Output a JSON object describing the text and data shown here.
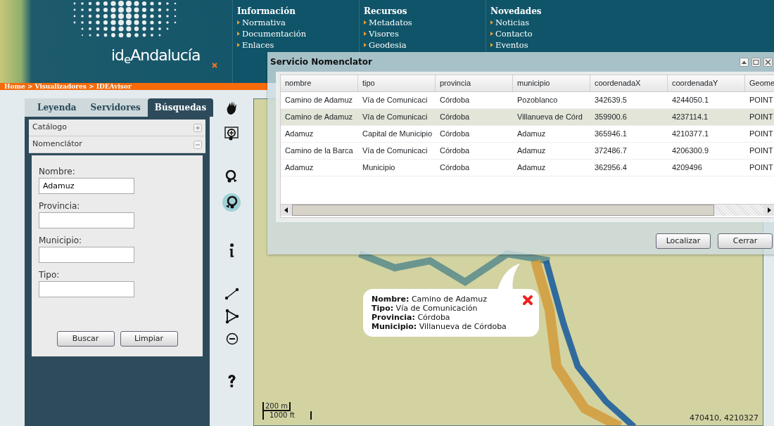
{
  "header": {
    "logo": "id$_{e}$Andalucía",
    "menus": [
      {
        "title": "Información",
        "links": [
          "Normativa",
          "Documentación",
          "Enlaces"
        ]
      },
      {
        "title": "Recursos",
        "links": [
          "Metadatos",
          "Visores",
          "Geodesia"
        ]
      },
      {
        "title": "Novedades",
        "links": [
          "Noticias",
          "Contacto",
          "Eventos"
        ]
      }
    ]
  },
  "breadcrumb": "Home > Visualizadores > IDEAvisor",
  "sidebar": {
    "tabs": [
      {
        "label": "Leyenda",
        "selected": false
      },
      {
        "label": "Servidores",
        "selected": false
      },
      {
        "label": "Búsquedas",
        "selected": true
      }
    ],
    "sections": [
      {
        "title": "Catálogo",
        "expanded": false
      },
      {
        "title": "Nomenclátor",
        "expanded": true
      }
    ],
    "form": {
      "fields": [
        {
          "label": "Nombre:",
          "value": "Adamuz"
        },
        {
          "label": "Provincia:"
        },
        {
          "label": "Municipio:"
        },
        {
          "label": "Tipo:"
        }
      ],
      "buttons": [
        "Buscar",
        "Limpiar"
      ]
    }
  },
  "toolbar": [
    {
      "kind": "pan",
      "selected": false
    },
    {
      "kind": "zoom-box",
      "selected": false
    },
    {
      "kind": "zoom-in",
      "selected": false
    },
    {
      "kind": "zoom-out",
      "selected": true
    },
    {
      "kind": "info",
      "selected": false
    },
    {
      "kind": "line",
      "selected": false
    },
    {
      "kind": "area",
      "selected": false
    },
    {
      "kind": "clear",
      "selected": false
    },
    {
      "kind": "help",
      "selected": false
    }
  ],
  "map": {
    "popup": {
      "lines": [
        "**Nombre:** Camino de Adamuz",
        "**Tipo:** Vía de Comunicación",
        "**Provincia:** Córdoba",
        "**Municipio:** Villanueva de Córdoba"
      ]
    },
    "scale": [
      "200 m",
      "1000 ft"
    ],
    "coordinates": "470410, 4210327"
  },
  "dialog": {
    "title": "Servicio Nomenclator",
    "table": {
      "columns": [
        "nombre",
        "tipo",
        "provincia",
        "municipio",
        "coordenadaX",
        "coordenadaY",
        "Geome"
      ],
      "rows": [
        {
          "selected": false,
          "cells": [
            "Camino de Adamuz",
            "Vía de Comunicaci",
            "Córdoba",
            "Pozoblanco",
            "342639.5",
            "4244050.1",
            "POINT"
          ]
        },
        {
          "selected": true,
          "cells": [
            "Camino de Adamuz",
            "Vía de Comunicaci",
            "Córdoba",
            "Villanueva de Córd",
            "359900.6",
            "4237114.1",
            "POINT"
          ]
        },
        {
          "selected": false,
          "cells": [
            "Adamuz",
            "Capital de Municipio",
            "Córdoba",
            "Adamuz",
            "365946.1",
            "4210377.1",
            "POINT"
          ]
        },
        {
          "selected": false,
          "cells": [
            "Camino de la Barca",
            "Vía de Comunicaci",
            "Córdoba",
            "Adamuz",
            "372486.7",
            "4206300.9",
            "POINT"
          ]
        },
        {
          "selected": false,
          "cells": [
            "Adamuz",
            "Municipio",
            "Córdoba",
            "Adamuz",
            "362956.4",
            "4209496",
            "POINT"
          ]
        }
      ]
    },
    "buttons": [
      "Localizar",
      "Cerrar"
    ]
  }
}
